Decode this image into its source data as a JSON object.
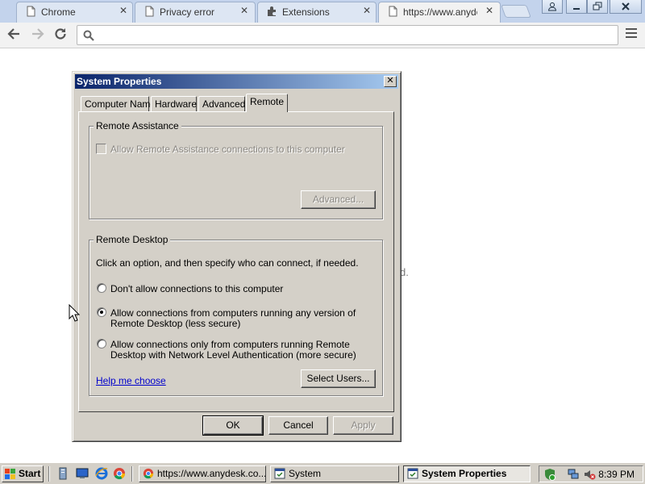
{
  "browser": {
    "tabs": [
      {
        "title": "Chrome"
      },
      {
        "title": "Privacy error"
      },
      {
        "title": "Extensions"
      },
      {
        "title": "https://www.anydesk.com"
      }
    ],
    "close_glyph": "✕",
    "omnibox": {
      "value": "",
      "placeholder": ""
    },
    "page_text_fragment": "d."
  },
  "dialog": {
    "title": "System Properties",
    "close_glyph": "✕",
    "tabs": [
      {
        "label": "Computer Name"
      },
      {
        "label": "Hardware"
      },
      {
        "label": "Advanced"
      },
      {
        "label": "Remote"
      }
    ],
    "selected_tab": "Remote",
    "remote_assistance": {
      "legend": "Remote Assistance",
      "checkbox_label": "Allow Remote Assistance connections to this computer",
      "checked": false,
      "enabled": false,
      "advanced_button": "Advanced..."
    },
    "remote_desktop": {
      "legend": "Remote Desktop",
      "instructions": "Click an option, and then specify who can connect, if needed.",
      "options": [
        {
          "line1": "Don't allow connections to this computer",
          "line2": ""
        },
        {
          "line1": "Allow connections from computers running any version of",
          "line2": "Remote Desktop (less secure)"
        },
        {
          "line1": "Allow connections only from computers running Remote",
          "line2": "Desktop with Network Level Authentication (more secure)"
        }
      ],
      "selected_option": 1,
      "help_link": "Help me choose",
      "select_users_button": "Select Users..."
    },
    "buttons": {
      "ok": "OK",
      "cancel": "Cancel",
      "apply": "Apply"
    }
  },
  "taskbar": {
    "start_label": "Start",
    "tasks": [
      {
        "label": "https://www.anydesk.co..."
      },
      {
        "label": "System"
      },
      {
        "label": "System Properties"
      }
    ],
    "clock": "8:39 PM"
  },
  "colors": {
    "titlebar_start": "#0a246a",
    "titlebar_end": "#a6caf0",
    "dialog_face": "#d4d0c8",
    "link": "#0000cc"
  }
}
